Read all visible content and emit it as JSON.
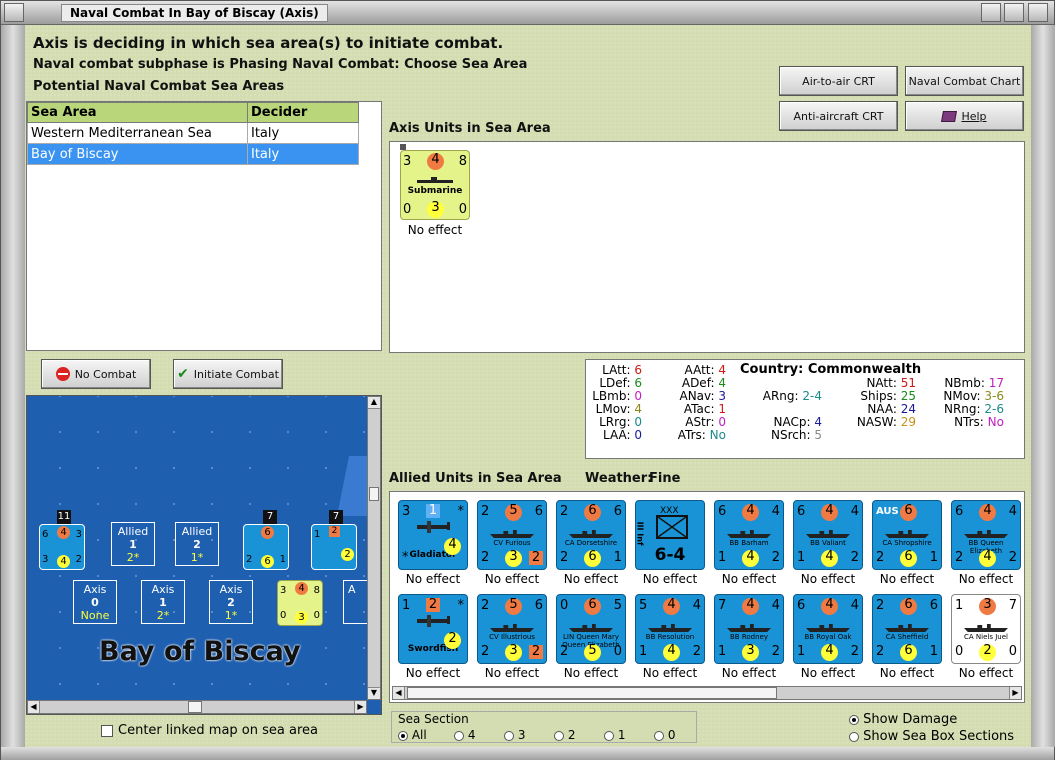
{
  "window": {
    "title": "Naval Combat In Bay of Biscay (Axis)"
  },
  "header": {
    "line1": "Axis is deciding in which sea area(s) to initiate combat.",
    "line2": "Naval combat subphase is Phasing Naval Combat: Choose Sea Area",
    "line3": "Potential Naval Combat Sea Areas"
  },
  "buttons": {
    "air": "Air-to-air CRT",
    "naval": "Naval Combat Chart",
    "aa": "Anti-aircraft CRT",
    "help": "Help",
    "no_combat": "No Combat",
    "initiate": "Initiate Combat"
  },
  "table": {
    "col1": "Sea Area",
    "col2": "Decider",
    "rows": [
      {
        "area": "Western Mediterranean Sea",
        "decider": "Italy"
      },
      {
        "area": "Bay of Biscay",
        "decider": "Italy"
      }
    ]
  },
  "axis_units": {
    "heading": "Axis Units in Sea Area",
    "unit": {
      "tl": "3",
      "tc": "4",
      "tr": "8",
      "name": "Submarine",
      "bl": "0",
      "bc": "3",
      "br": "0",
      "effect": "No effect"
    }
  },
  "stats": {
    "latt_l": "LAtt:",
    "latt": "6",
    "ldef_l": "LDef:",
    "ldef": "6",
    "lbmb_l": "LBmb:",
    "lbmb": "0",
    "lmov_l": "LMov:",
    "lmov": "4",
    "lrrg_l": "LRrg:",
    "lrrg": "0",
    "laa_l": "LAA:",
    "laa": "0",
    "aatt_l": "AAtt:",
    "aatt": "4",
    "adef_l": "ADef:",
    "adef": "4",
    "anav_l": "ANav:",
    "anav": "3",
    "atac_l": "ATac:",
    "atac": "1",
    "astr_l": "AStr:",
    "astr": "0",
    "atrs_l": "ATrs:",
    "atrs": "No",
    "country_l": "Country:",
    "country": "Commonwealth",
    "arng_l": "ARng:",
    "arng": "2-4",
    "nacp_l": "NACp:",
    "nacp": "4",
    "nsrch_l": "NSrch:",
    "nsrch": "5",
    "natt_l": "NAtt:",
    "natt": "51",
    "ships_l": "Ships:",
    "ships": "25",
    "naa_l": "NAA:",
    "naa": "24",
    "nasw_l": "NASW:",
    "nasw": "29",
    "nbmb_l": "NBmb:",
    "nbmb": "17",
    "nmov_l": "NMov:",
    "nmov": "3-6",
    "nrng_l": "NRng:",
    "nrng": "2-6",
    "ntrs_l": "NTrs:",
    "ntrs": "No"
  },
  "allied": {
    "heading": "Allied Units in Sea Area",
    "weather_l": "Weather:",
    "weather": "Fine",
    "effect": "No effect",
    "row1": [
      {
        "tl": "3",
        "tc": "1",
        "tr": "*",
        "name": "Gladiator",
        "bl": "*",
        "bc": "4",
        "br": ""
      },
      {
        "tl": "2",
        "tc": "5",
        "tr": "6",
        "name": "CV Furious",
        "bl": "2",
        "bc": "3",
        "br": "2"
      },
      {
        "tl": "2",
        "tc": "6",
        "tr": "6",
        "name": "CA Dorsetshire",
        "bl": "2",
        "bc": "6",
        "br": "1"
      },
      {
        "tl": "",
        "tc": "XXX",
        "tr": "",
        "name": "III Inf",
        "bl": "",
        "bc": "6-4",
        "br": ""
      },
      {
        "tl": "6",
        "tc": "4",
        "tr": "4",
        "name": "BB Barham",
        "bl": "1",
        "bc": "4",
        "br": "2"
      },
      {
        "tl": "6",
        "tc": "4",
        "tr": "4",
        "name": "BB Valiant",
        "bl": "1",
        "bc": "4",
        "br": "2"
      },
      {
        "tl": "AUS",
        "tc": "6",
        "tr": "",
        "name": "CA Shropshire",
        "bl": "2",
        "bc": "6",
        "br": "1"
      },
      {
        "tl": "6",
        "tc": "4",
        "tr": "4",
        "name": "BB Queen Elizabeth",
        "bl": "2",
        "bc": "4",
        "br": "2"
      }
    ],
    "row2": [
      {
        "tl": "1",
        "tc": "2",
        "tr": "*",
        "name": "Swordfish",
        "bl": "",
        "bc": "2",
        "br": ""
      },
      {
        "tl": "2",
        "tc": "5",
        "tr": "6",
        "name": "CV Illustrious",
        "bl": "2",
        "bc": "3",
        "br": "2"
      },
      {
        "tl": "0",
        "tc": "6",
        "tr": "5",
        "name": "LIN Queen Mary Queen Elizabeth",
        "bl": "2",
        "bc": "5",
        "br": "0"
      },
      {
        "tl": "5",
        "tc": "4",
        "tr": "4",
        "name": "BB Resolution",
        "bl": "1",
        "bc": "4",
        "br": "2"
      },
      {
        "tl": "7",
        "tc": "4",
        "tr": "4",
        "name": "BB Rodney",
        "bl": "1",
        "bc": "3",
        "br": "2"
      },
      {
        "tl": "6",
        "tc": "4",
        "tr": "4",
        "name": "BB Royal Oak",
        "bl": "1",
        "bc": "4",
        "br": "2"
      },
      {
        "tl": "2",
        "tc": "6",
        "tr": "6",
        "name": "CA Sheffield",
        "bl": "2",
        "bc": "6",
        "br": "1"
      },
      {
        "tl": "1",
        "tc": "3",
        "tr": "7",
        "name": "CA Niels Juel",
        "bl": "0",
        "bc": "2",
        "br": "0"
      }
    ]
  },
  "map": {
    "title": "Bay of Biscay",
    "stack1_count": "11",
    "stack2_count": "7",
    "stack3_count": "7",
    "allied1": {
      "a": "Allied",
      "b": "1",
      "c": "2*"
    },
    "allied2": {
      "a": "Allied",
      "b": "2",
      "c": "1*"
    },
    "axis0": {
      "a": "Axis",
      "b": "0",
      "c": "None"
    },
    "axis1": {
      "a": "Axis",
      "b": "1",
      "c": "2*"
    },
    "axis2": {
      "a": "Axis",
      "b": "2",
      "c": "1*"
    },
    "axis_partial": "A"
  },
  "checkbox": {
    "center": "Center linked map on sea area"
  },
  "sea_section": {
    "label": "Sea Section",
    "all": "All",
    "s4": "4",
    "s3": "3",
    "s2": "2",
    "s1": "1",
    "s0": "0"
  },
  "display": {
    "damage": "Show Damage",
    "boxes": "Show Sea Box Sections"
  },
  "colors": {
    "counter_blue": "#1a93d6",
    "accent_green": "#b9d67a",
    "selection": "#3a93f0"
  }
}
